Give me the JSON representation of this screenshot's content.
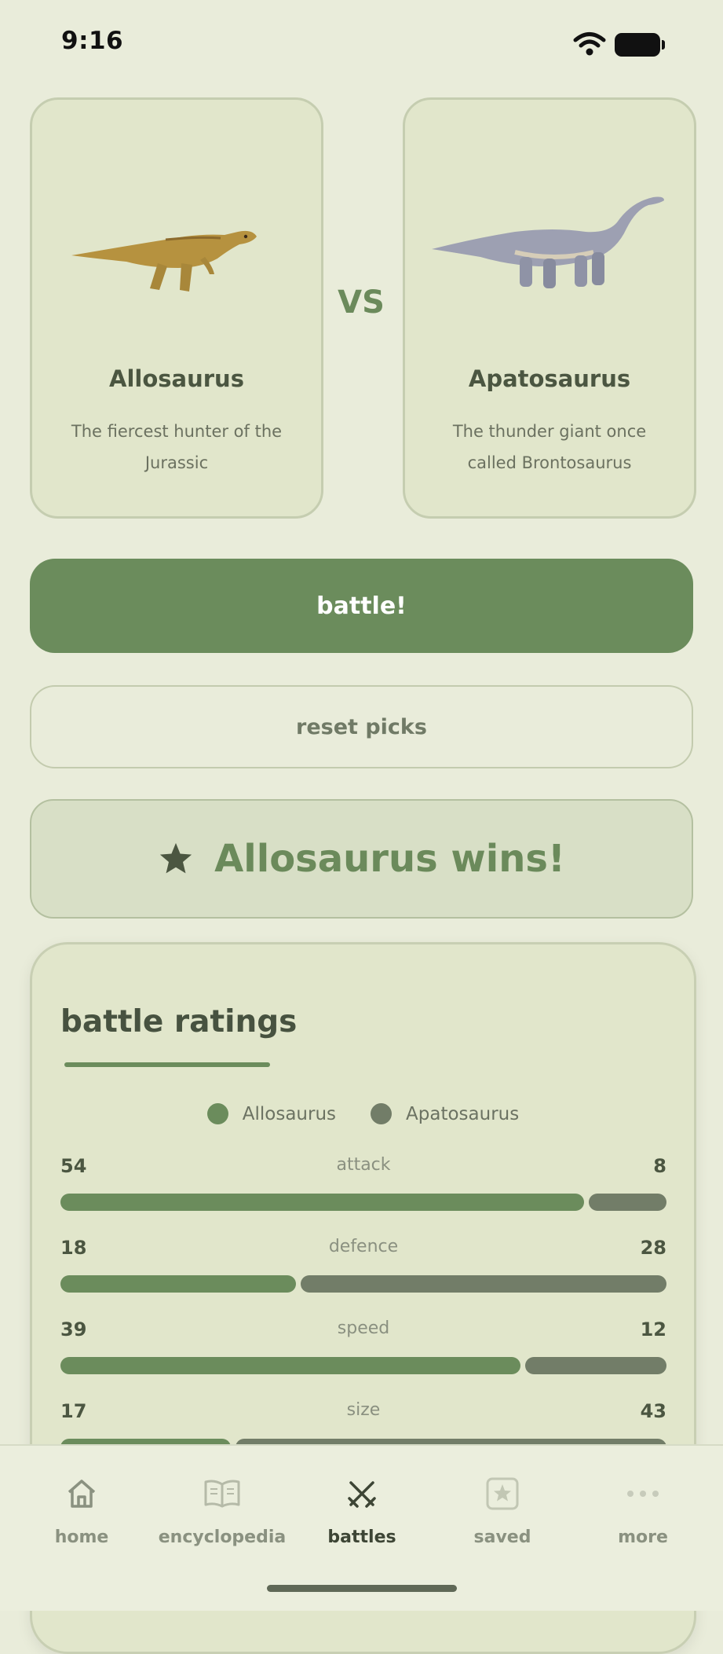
{
  "status": {
    "time": "9:16"
  },
  "matchup": {
    "left": {
      "name": "Allosaurus",
      "description": "The fiercest hunter of the Jurassic"
    },
    "vs": "VS",
    "right": {
      "name": "Apatosaurus",
      "description": "The thunder giant once called Brontosaurus"
    }
  },
  "actions": {
    "battle_label": "battle!",
    "reset_label": "reset picks"
  },
  "result": {
    "text": "Allosaurus wins!"
  },
  "ratings": {
    "title": "battle ratings",
    "legend": [
      {
        "label": "Allosaurus",
        "color": "#6b8c5c"
      },
      {
        "label": "Apatosaurus",
        "color": "#727d68"
      }
    ],
    "stats": [
      {
        "label": "attack",
        "left": "54",
        "right": "8"
      },
      {
        "label": "defence",
        "left": "18",
        "right": "28"
      },
      {
        "label": "speed",
        "left": "39",
        "right": "12"
      },
      {
        "label": "size",
        "left": "17",
        "right": "43"
      }
    ]
  },
  "tabs": [
    {
      "label": "home",
      "icon": "house-icon",
      "active": false
    },
    {
      "label": "encyclopedia",
      "icon": "book-icon",
      "active": false
    },
    {
      "label": "battles",
      "icon": "crossed-swords-icon",
      "active": true
    },
    {
      "label": "saved",
      "icon": "star-square-icon",
      "active": false
    },
    {
      "label": "more",
      "icon": "ellipsis-icon",
      "active": false
    }
  ],
  "colors": {
    "accent": "#6b8c5c",
    "background": "#e9ecda",
    "card": "#e1e6cb",
    "secondary_bar": "#727d68",
    "tab_active": "#3d4535",
    "tab_inactive": "#8a9180"
  }
}
